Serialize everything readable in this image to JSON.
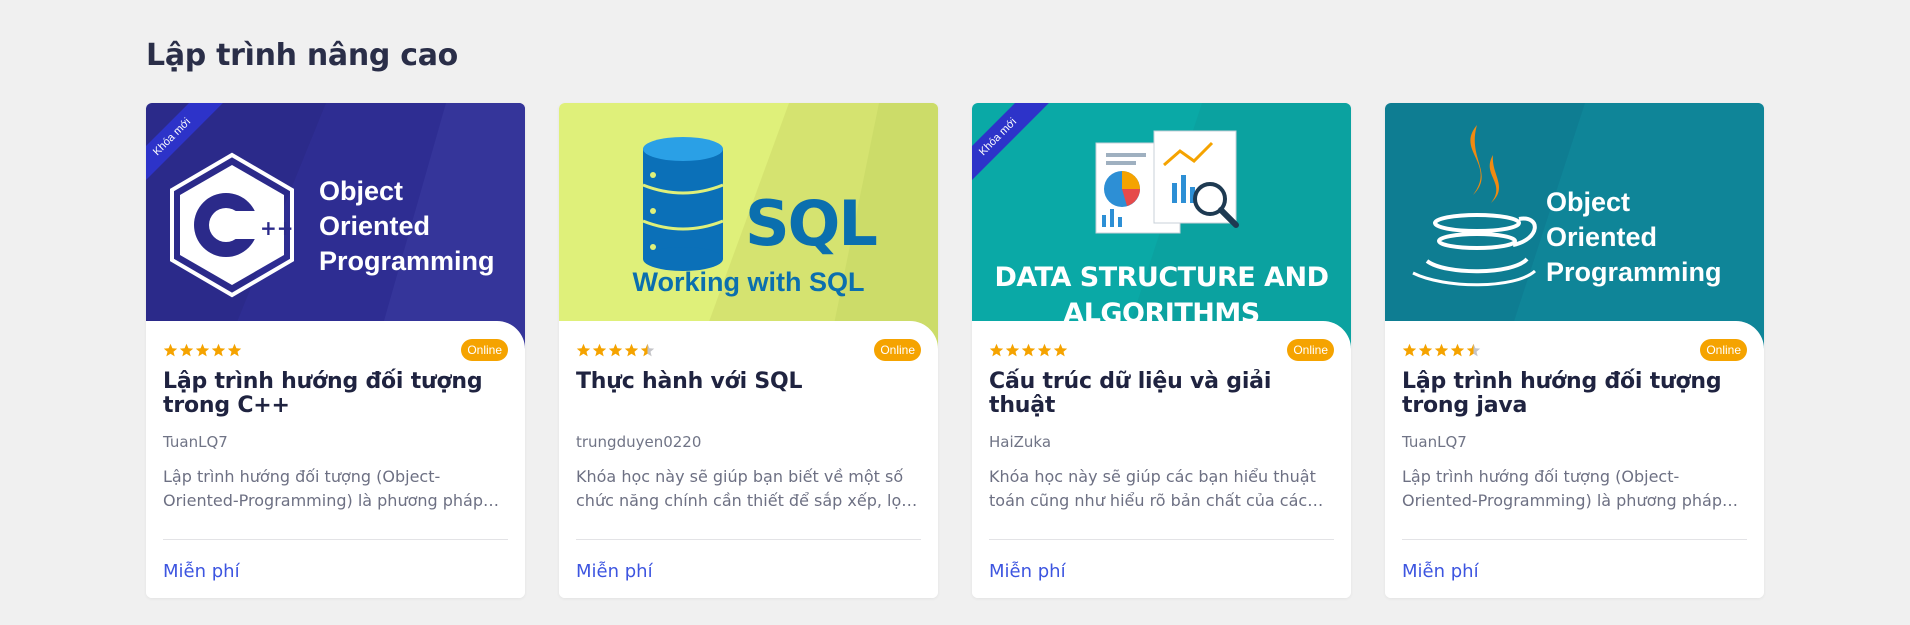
{
  "section": {
    "title": "Lập trình nâng cao"
  },
  "colors": {
    "accent": "#3d55e0",
    "badge": "#f5a300",
    "ribbon": "#2d33c9",
    "star": "#f5a300"
  },
  "cards": [
    {
      "thumbnail_lines": [
        "Object",
        "Oriented",
        "Programming"
      ],
      "thumbnail_icon": "cpp-logo-icon",
      "ribbon": "Khóa mới",
      "rating": 5,
      "badge": "Online",
      "title": "Lập trình hướng đối tượng trong C++",
      "author": "TuanLQ7",
      "description": "Lập trình hướng đối tượng (Object-Oriented-Programming) là phương pháp lập trình dựa trên khái niệm đối tượng",
      "price": "Miễn phí"
    },
    {
      "thumbnail_lines": [
        "SQL",
        "Working with SQL"
      ],
      "thumbnail_icon": "database-icon",
      "ribbon": "",
      "rating": 4.5,
      "badge": "Online",
      "title": "Thực hành với SQL",
      "author": "trungduyen0220",
      "description": "Khóa học này sẽ giúp bạn biết về một số chức năng chính cần thiết để sắp xếp, lọc và tổng hợp dữ liệu",
      "price": "Miễn phí"
    },
    {
      "thumbnail_lines": [
        "DATA STRUCTURE AND",
        "ALGORITHMS"
      ],
      "thumbnail_icon": "data-analysis-icon",
      "ribbon": "Khóa mới",
      "rating": 5,
      "badge": "Online",
      "title": "Cấu trúc dữ liệu và giải thuật",
      "author": "HaiZuka",
      "description": "Khóa học này sẽ giúp các bạn hiểu thuật toán cũng như hiểu rõ bản chất của các cấu trúc dữ liệu",
      "price": "Miễn phí"
    },
    {
      "thumbnail_lines": [
        "Object",
        "Oriented",
        "Programming"
      ],
      "thumbnail_icon": "java-logo-icon",
      "ribbon": "",
      "rating": 4.5,
      "badge": "Online",
      "title": "Lập trình hướng đối tượng trong java",
      "author": "TuanLQ7",
      "description": "Lập trình hướng đối tượng (Object-Oriented-Programming) là phương pháp lập trình dựa trên khái niệm đối tượng",
      "price": "Miễn phí"
    }
  ]
}
